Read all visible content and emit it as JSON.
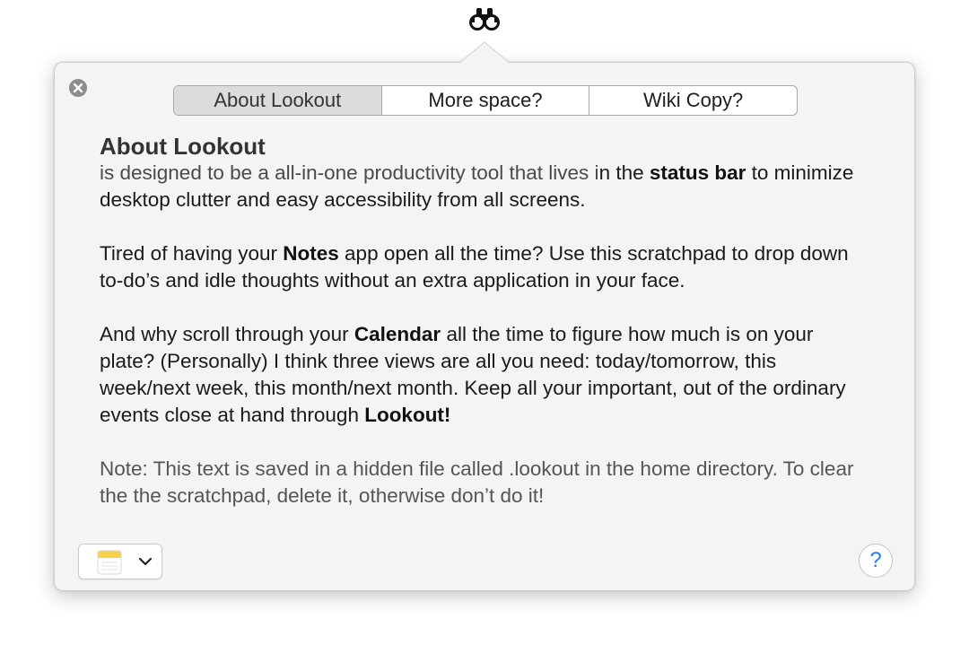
{
  "statusbar": {
    "icon": "binoculars-icon"
  },
  "popover": {
    "close_icon": "close-icon",
    "tabs": [
      {
        "label": "About Lookout",
        "selected": true
      },
      {
        "label": "More space?",
        "selected": false
      },
      {
        "label": "Wiki Copy?",
        "selected": false
      }
    ],
    "heading": "About Lookout",
    "p1": {
      "a": "is designed to be a all-in-one productivity tool that lives i",
      "b": "n the ",
      "bold": "status bar",
      "c": " to minimize desktop clutter and easy accessibility from all screens."
    },
    "p2": {
      "a": "Tired of having your ",
      "bold": "Notes",
      "b": " app open all the time? Use this scratchpad to drop down to-do’s and idle thoughts without an extra application in your face."
    },
    "p3": {
      "a": "And why scroll through your ",
      "bold": "Calendar",
      "b": " all the time to figure how much is on your plate? (Personally) I think three views are all you need: today/tomorrow, this week/next week, this month/next month. Keep all your important, out of the ordinary events close at hand through ",
      "bold2": "Lookout!"
    },
    "note": "Note: This text is saved in a hidden file called .lookout in the home directory. To clear the the scratchpad, delete it, otherwise don’t do it!",
    "app_selector": {
      "icon": "notes-app-icon",
      "chevron": "chevron-down-icon"
    },
    "help_label": "?"
  },
  "colors": {
    "panel_bg": "#f4f4f4",
    "segment_selected": "#dcdcdc",
    "help_blue": "#2a7bf6",
    "close_gray": "#8c8c8c"
  }
}
